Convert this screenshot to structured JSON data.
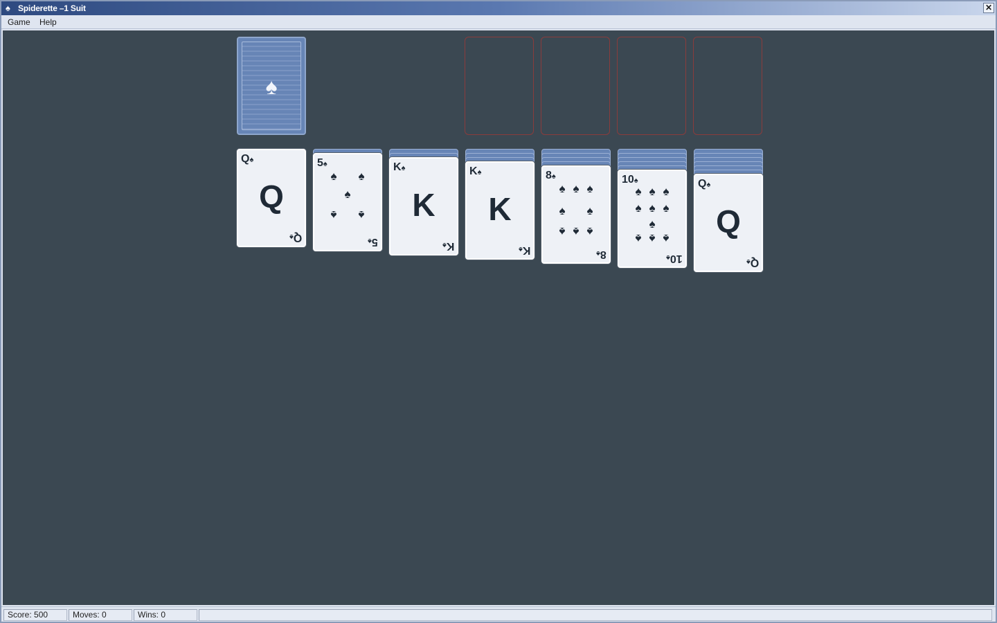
{
  "window": {
    "title": "Spiderette –1 Suit",
    "close_label": "✕",
    "app_icon": "spade-icon"
  },
  "menu": {
    "items": [
      "Game",
      "Help"
    ]
  },
  "status": {
    "score": "Score: 500",
    "moves": "Moves: 0",
    "wins": "Wins: 0"
  },
  "stock": {
    "symbol": "♠"
  },
  "colors": {
    "table": "#3b4852",
    "card_back": "#6785b6",
    "foundation_outline": "#8a3c3c"
  },
  "tableau": [
    {
      "hidden": 0,
      "rank": "Q",
      "suit": "♠"
    },
    {
      "hidden": 1,
      "rank": "5",
      "suit": "♠"
    },
    {
      "hidden": 2,
      "rank": "K",
      "suit": "♠"
    },
    {
      "hidden": 3,
      "rank": "K",
      "suit": "♠"
    },
    {
      "hidden": 4,
      "rank": "8",
      "suit": "♠"
    },
    {
      "hidden": 5,
      "rank": "10",
      "suit": "♠"
    },
    {
      "hidden": 6,
      "rank": "Q",
      "suit": "♠"
    }
  ]
}
